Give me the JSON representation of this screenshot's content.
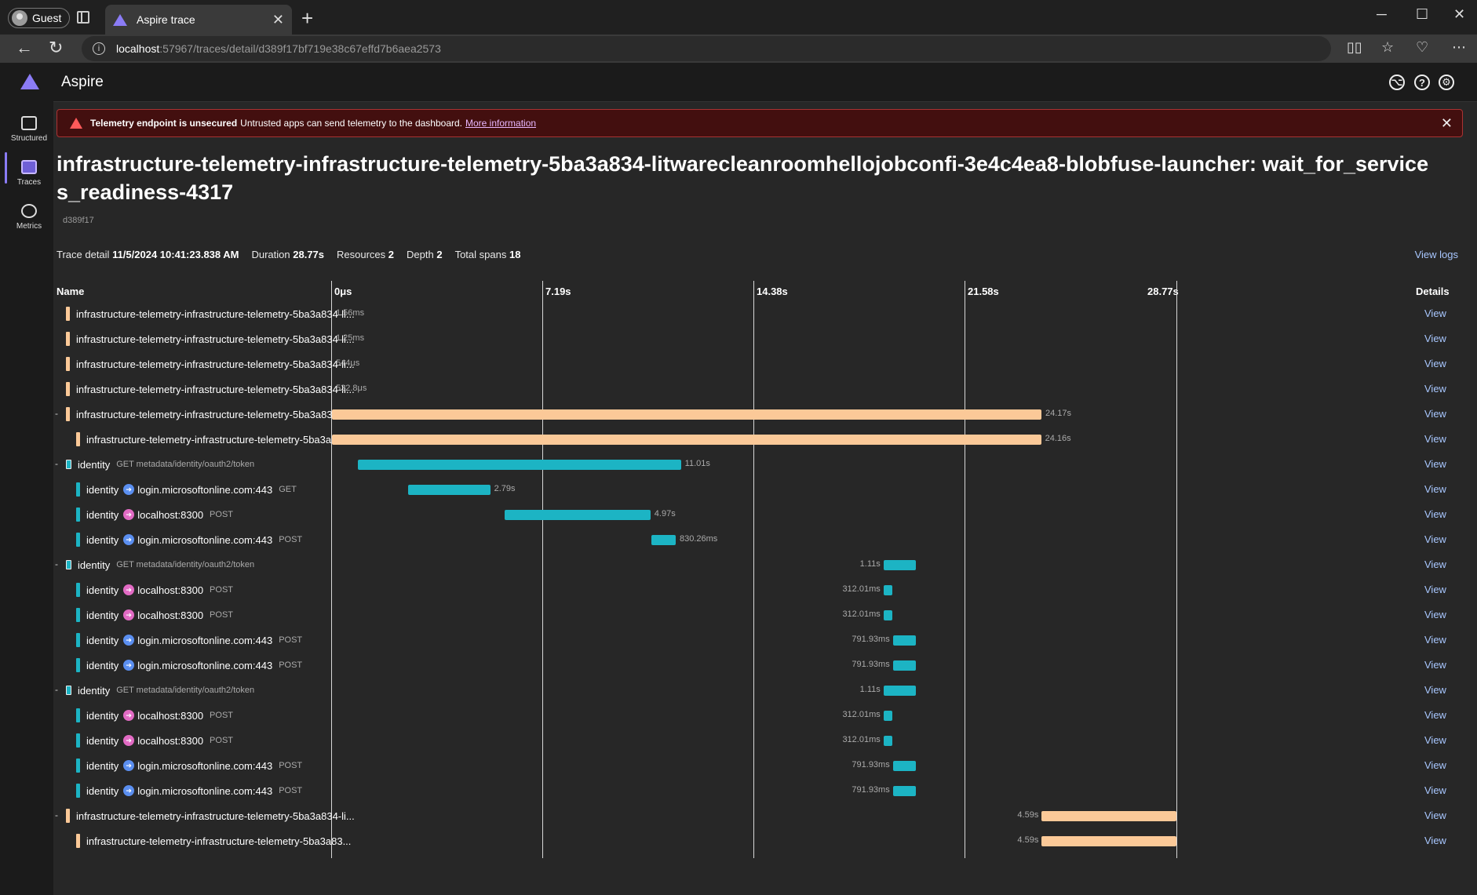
{
  "browser": {
    "profile": "Guest",
    "tab_title": "Aspire trace",
    "url_host": "localhost",
    "url_path": ":57967/traces/detail/d389f17bf719e38c67effd7b6aea2573"
  },
  "app": {
    "title": "Aspire"
  },
  "sidebar": {
    "items": [
      {
        "label": "Structured",
        "icon": "structured-logs-icon"
      },
      {
        "label": "Traces",
        "icon": "traces-icon"
      },
      {
        "label": "Metrics",
        "icon": "metrics-icon"
      }
    ]
  },
  "banner": {
    "title": "Telemetry endpoint is unsecured",
    "message": "Untrusted apps can send telemetry to the dashboard.",
    "link": "More information"
  },
  "page": {
    "title": "infrastructure-telemetry-infrastructure-telemetry-5ba3a834-litwarecleanroomhellojobconfi-3e4c4ea8-blobfuse-launcher: wait_for_services_readiness-4317",
    "trace_id": "d389f17"
  },
  "summary": {
    "trace_detail_label": "Trace detail",
    "trace_detail_value": "11/5/2024 10:41:23.838 AM",
    "duration_label": "Duration",
    "duration_value": "28.77s",
    "resources_label": "Resources",
    "resources_value": "2",
    "depth_label": "Depth",
    "depth_value": "2",
    "spans_label": "Total spans",
    "spans_value": "18",
    "view_logs": "View logs"
  },
  "columns": {
    "name": "Name",
    "details": "Details",
    "ticks": [
      "0μs",
      "7.19s",
      "14.38s",
      "21.58s",
      "28.77s"
    ]
  },
  "colors": {
    "orange": "#fbc998",
    "teal": "#1cb4c4",
    "blue_dot": "#5b8ff0",
    "pink_dot": "#e26bc4",
    "link": "#a8c7ff"
  },
  "spans": [
    {
      "name": "infrastructure-telemetry-infrastructure-telemetry-5ba3a834-li...",
      "sub": "",
      "depth": 1,
      "color": "orange",
      "collapse": "",
      "icon": "",
      "start": 0,
      "dur_s": 0.00156,
      "dur": "1.56ms",
      "label_side": "right"
    },
    {
      "name": "infrastructure-telemetry-infrastructure-telemetry-5ba3a834-li...",
      "sub": "",
      "depth": 1,
      "color": "orange",
      "collapse": "",
      "icon": "",
      "start": 0,
      "dur_s": 0.00125,
      "dur": "1.25ms",
      "label_side": "right"
    },
    {
      "name": "infrastructure-telemetry-infrastructure-telemetry-5ba3a834-li...",
      "sub": "",
      "depth": 1,
      "color": "orange",
      "collapse": "",
      "icon": "",
      "start": 0,
      "dur_s": 0.000544,
      "dur": "544μs",
      "label_side": "right"
    },
    {
      "name": "infrastructure-telemetry-infrastructure-telemetry-5ba3a834-li...",
      "sub": "",
      "depth": 1,
      "color": "orange",
      "collapse": "",
      "icon": "",
      "start": 0,
      "dur_s": 0.0005328,
      "dur": "532.8μs",
      "label_side": "right"
    },
    {
      "name": "infrastructure-telemetry-infrastructure-telemetry-5ba3a834-li...",
      "sub": "",
      "depth": 1,
      "color": "orange",
      "collapse": "-",
      "icon": "",
      "start": 0,
      "dur_s": 24.17,
      "dur": "24.17s",
      "label_side": "right"
    },
    {
      "name": "infrastructure-telemetry-infrastructure-telemetry-5ba3a83...",
      "sub": "",
      "depth": 2,
      "color": "orange",
      "collapse": "",
      "icon": "",
      "start": 0,
      "dur_s": 24.16,
      "dur": "24.16s",
      "label_side": "right"
    },
    {
      "name": "identity",
      "sub": "GET metadata/identity/oauth2/token",
      "depth": 1,
      "color": "teal",
      "collapse": "-",
      "icon": "",
      "start": 0.88,
      "dur_s": 11.01,
      "dur": "11.01s",
      "label_side": "right"
    },
    {
      "name": "identity",
      "target": "login.microsoftonline.com:443",
      "sub": "GET",
      "depth": 2,
      "color": "teal",
      "collapse": "",
      "icon": "blue",
      "start": 2.6,
      "dur_s": 2.79,
      "dur": "2.79s",
      "label_side": "right"
    },
    {
      "name": "identity",
      "target": "localhost:8300",
      "sub": "POST",
      "depth": 2,
      "color": "teal",
      "collapse": "",
      "icon": "pink",
      "start": 5.88,
      "dur_s": 4.97,
      "dur": "4.97s",
      "label_side": "right"
    },
    {
      "name": "identity",
      "target": "login.microsoftonline.com:443",
      "sub": "POST",
      "depth": 2,
      "color": "teal",
      "collapse": "",
      "icon": "blue",
      "start": 10.88,
      "dur_s": 0.83026,
      "dur": "830.26ms",
      "label_side": "right"
    },
    {
      "name": "identity",
      "sub": "GET metadata/identity/oauth2/token",
      "depth": 1,
      "color": "teal",
      "collapse": "-",
      "icon": "",
      "start": 18.79,
      "dur_s": 1.11,
      "dur": "1.11s",
      "label_side": "left"
    },
    {
      "name": "identity",
      "target": "localhost:8300",
      "sub": "POST",
      "depth": 2,
      "color": "teal",
      "collapse": "",
      "icon": "pink",
      "start": 18.79,
      "dur_s": 0.31201,
      "dur": "312.01ms",
      "label_side": "left"
    },
    {
      "name": "identity",
      "target": "localhost:8300",
      "sub": "POST",
      "depth": 2,
      "color": "teal",
      "collapse": "",
      "icon": "pink",
      "start": 18.79,
      "dur_s": 0.31201,
      "dur": "312.01ms",
      "label_side": "left"
    },
    {
      "name": "identity",
      "target": "login.microsoftonline.com:443",
      "sub": "POST",
      "depth": 2,
      "color": "teal",
      "collapse": "",
      "icon": "blue",
      "start": 19.11,
      "dur_s": 0.79193,
      "dur": "791.93ms",
      "label_side": "left"
    },
    {
      "name": "identity",
      "target": "login.microsoftonline.com:443",
      "sub": "POST",
      "depth": 2,
      "color": "teal",
      "collapse": "",
      "icon": "blue",
      "start": 19.11,
      "dur_s": 0.79193,
      "dur": "791.93ms",
      "label_side": "left"
    },
    {
      "name": "identity",
      "sub": "GET metadata/identity/oauth2/token",
      "depth": 1,
      "color": "teal",
      "collapse": "-",
      "icon": "",
      "start": 18.79,
      "dur_s": 1.11,
      "dur": "1.11s",
      "label_side": "left"
    },
    {
      "name": "identity",
      "target": "localhost:8300",
      "sub": "POST",
      "depth": 2,
      "color": "teal",
      "collapse": "",
      "icon": "pink",
      "start": 18.79,
      "dur_s": 0.31201,
      "dur": "312.01ms",
      "label_side": "left"
    },
    {
      "name": "identity",
      "target": "localhost:8300",
      "sub": "POST",
      "depth": 2,
      "color": "teal",
      "collapse": "",
      "icon": "pink",
      "start": 18.79,
      "dur_s": 0.31201,
      "dur": "312.01ms",
      "label_side": "left"
    },
    {
      "name": "identity",
      "target": "login.microsoftonline.com:443",
      "sub": "POST",
      "depth": 2,
      "color": "teal",
      "collapse": "",
      "icon": "blue",
      "start": 19.11,
      "dur_s": 0.79193,
      "dur": "791.93ms",
      "label_side": "left"
    },
    {
      "name": "identity",
      "target": "login.microsoftonline.com:443",
      "sub": "POST",
      "depth": 2,
      "color": "teal",
      "collapse": "",
      "icon": "blue",
      "start": 19.11,
      "dur_s": 0.79193,
      "dur": "791.93ms",
      "label_side": "left"
    },
    {
      "name": "infrastructure-telemetry-infrastructure-telemetry-5ba3a834-li...",
      "sub": "",
      "depth": 1,
      "color": "orange",
      "collapse": "-",
      "icon": "",
      "start": 24.18,
      "dur_s": 4.59,
      "dur": "4.59s",
      "label_side": "left"
    },
    {
      "name": "infrastructure-telemetry-infrastructure-telemetry-5ba3a83...",
      "sub": "",
      "depth": 2,
      "color": "orange",
      "collapse": "",
      "icon": "",
      "start": 24.18,
      "dur_s": 4.59,
      "dur": "4.59s",
      "label_side": "left"
    }
  ],
  "view_label": "View",
  "total_duration_s": 28.77
}
